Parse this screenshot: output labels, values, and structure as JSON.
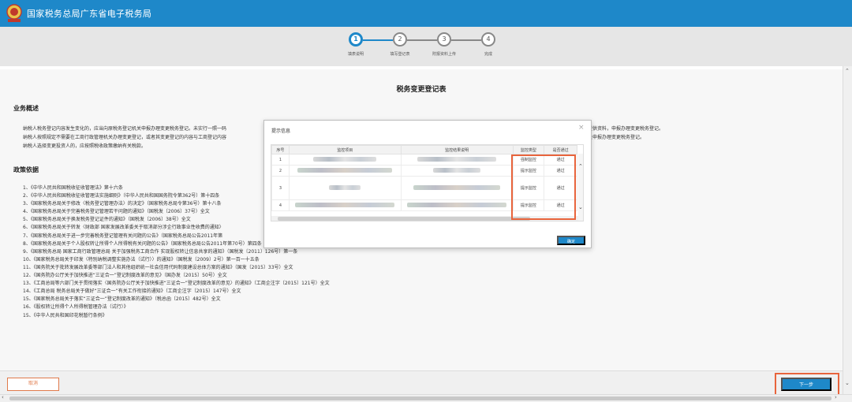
{
  "header": {
    "title": "国家税务总局广东省电子税务局",
    "bg_color": "#1e88c9"
  },
  "steps": [
    {
      "num": "1",
      "label": "填表说明",
      "active": true
    },
    {
      "num": "2",
      "label": "填写登记表",
      "active": false
    },
    {
      "num": "3",
      "label": "附报资料上传",
      "active": false
    },
    {
      "num": "4",
      "label": "完成",
      "active": false
    }
  ],
  "main": {
    "title": "税务变更登记表",
    "overview_heading": "业务概述",
    "overview_lines": [
      "纳税人税务登记内容发生变化的，应当向原税务登记机关申报办理变更税务登记。未实行一照一码",
      "纳税人按照规定不需要在工商行政管理机关办理变更登记，或者其变更登记的内容与工商登记内容",
      "纳税人选择变更投资人的，应按照税收政策缴纳有关税款。"
    ],
    "overview_tail_1": "提供资料，申报办理变更税务登记。",
    "overview_tail_2": "关申报办理变更税务登记。",
    "policy_heading": "政策依据",
    "policies": [
      "1、《中华人民共和国税收征收管理法》第十六条",
      "2、《中华人民共和国税收征收管理法实施细则》（中华人民共和国国务院令第362号）第十四条",
      "3、《国家税务总局关于修改〈税务登记管理办法〉的决定》（国家税务总局令第36号）第十八条",
      "4、《国家税务总局关于完善税务登记管理若干问题的通知》（国税发〔2006〕37号）全文",
      "5、《国家税务总局关于换发税务登记证件的通知》（国税发〔2006〕38号）全文",
      "6、《国家税务总局关于转发〈财政部 国家发展改革委关于取消部分涉企行政事业性收费的通知〉",
      "7、《国家税务总局关于进一步完善税务登记管理有关问题的公告》（国家税务总局公告2011年第",
      "8、《国家税务总局关于个人股权转让所得个人所得税有关问题的公告》（国家税务总局公告2011年第70号）第四条",
      "9、《国家税务总局 国家工商行政管理总局 关于加强税务工商合作 实现股权转让信息共享的通知》（国税发〔2011〕126号）第一条",
      "10、《国家税务总局关于印发〈特别纳税调整实施办法（试行）〉的通知》（国税发〔2009〕2号）第一百一十五条",
      "11、《国务院关于批转发展改革委等部门法人和其他组织统一社会信用代码制度建设总体方案的通知》（国发〔2015〕33号）全文",
      "12、《国务院办公厅关于加快推进“三证合一”登记制度改革的意见》（国办发〔2015〕50号）全文",
      "13、《工商总局等六部门关于贯彻落实〈国务院办公厅关于加快推进“三证合一”登记制度改革的意见〉的通知》（工商企注字〔2015〕121号）全文",
      "14、《工商总局 税务总局关于做好“三证合一”有关工作衔接的通知》（工商企注字〔2015〕147号）全文",
      "15、《国家税务总局关于落实“三证合一”登记制度改革的通知》（税总函〔2015〕482号）全文",
      "16、《股权转让所得个人所得税管理办法（试行）》",
      "15、《中华人民共和国印花税暂行条例》"
    ]
  },
  "footer": {
    "cancel_label": "取消",
    "next_label": "下一步"
  },
  "modal": {
    "title": "提示信息",
    "close_glyph": "×",
    "columns": [
      "序号",
      "监控项目",
      "监控结果说明",
      "监控类型",
      "是否通过"
    ],
    "rows": [
      {
        "no": "1",
        "type": "强制监控",
        "pass": "通过"
      },
      {
        "no": "2",
        "type": "提示监控",
        "pass": "通过"
      },
      {
        "no": "3",
        "type": "提示监控",
        "pass": "通过"
      },
      {
        "no": "4",
        "type": "提示监控",
        "pass": "通过"
      }
    ],
    "ok_label": "确定"
  },
  "highlight_color": "#e8643c"
}
